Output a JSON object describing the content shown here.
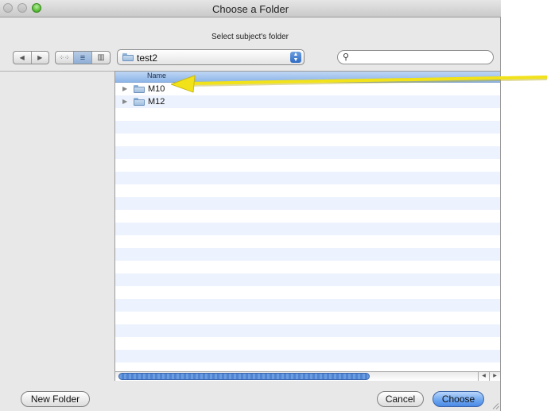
{
  "window": {
    "title": "Choose a Folder"
  },
  "prompt": "Select subject's folder",
  "toolbar": {
    "back_icon": "left-triangle-icon",
    "forward_icon": "right-triangle-icon",
    "view_modes": [
      {
        "name": "icon-view",
        "glyph": "⁘⁘",
        "active": false
      },
      {
        "name": "list-view",
        "glyph": "≡",
        "active": true
      },
      {
        "name": "column-view",
        "glyph": "▥",
        "active": false
      }
    ]
  },
  "location": {
    "selected": "test2"
  },
  "search": {
    "value": "",
    "placeholder": ""
  },
  "file_list": {
    "column_header": "Name",
    "rows": [
      {
        "name": "M10",
        "kind": "folder"
      },
      {
        "name": "M12",
        "kind": "folder"
      }
    ]
  },
  "buttons": {
    "new_folder": "New Folder",
    "cancel": "Cancel",
    "choose": "Choose"
  },
  "colors": {
    "annotation_arrow": "#f2e21a",
    "default_button": "#6aa4ef",
    "selection_header": "#a7c6ee",
    "alternate_row": "#edf3fe"
  }
}
